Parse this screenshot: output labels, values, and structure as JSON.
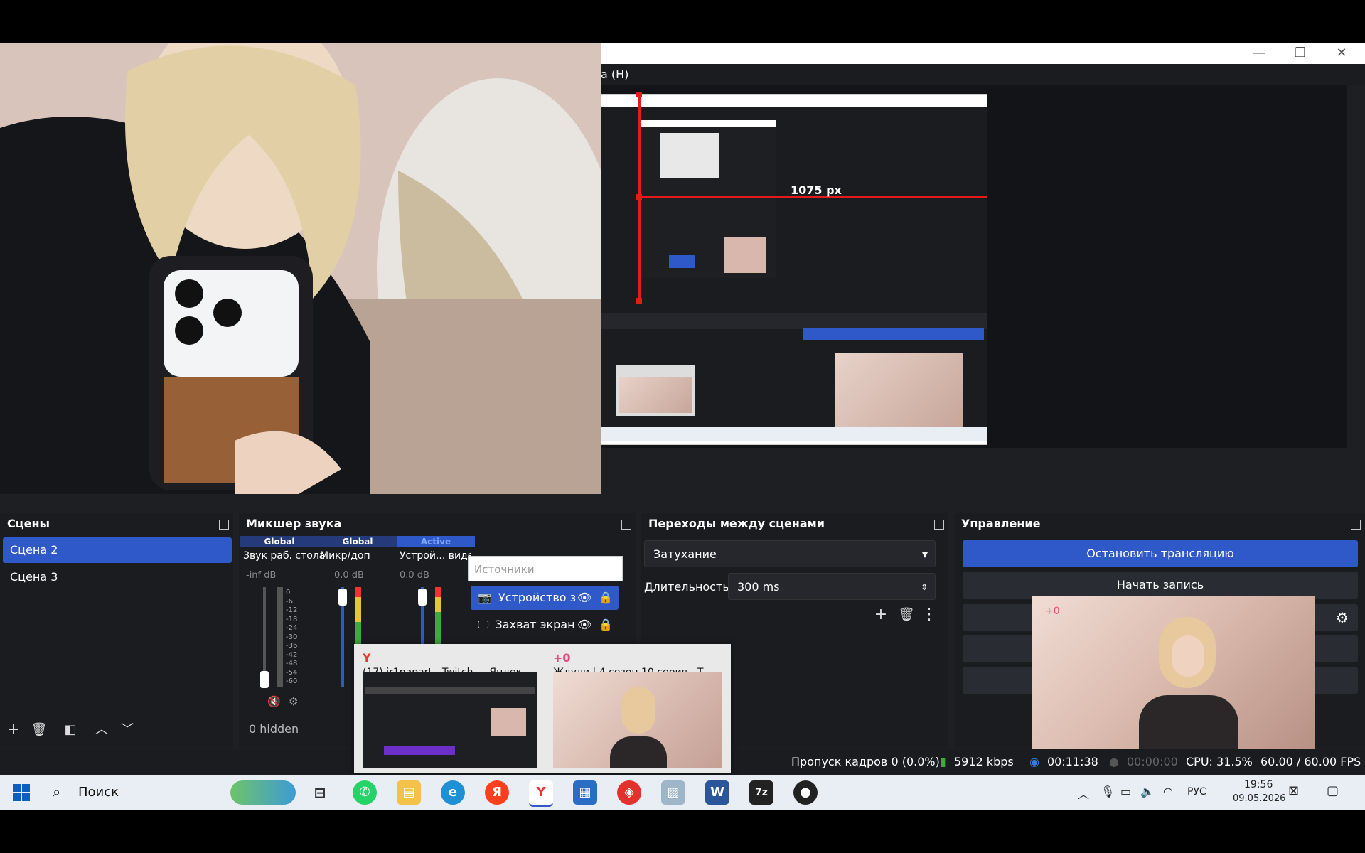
{
  "window": {
    "menu_fragment": "а (H)",
    "controls": {
      "minimize": "—",
      "restore": "❐",
      "close": "✕"
    }
  },
  "preview": {
    "dimension_label": "1075 px",
    "inner_scale_label": "1075 px"
  },
  "scenes": {
    "title": "Сцены",
    "items": [
      {
        "label": "Сцена 2",
        "active": true
      },
      {
        "label": "Сцена 3",
        "active": false
      }
    ]
  },
  "sources_popup": {
    "header_placeholder": "Источники",
    "items": [
      {
        "label": "Устройство з",
        "selected": true
      },
      {
        "label": "Захват экран",
        "selected": false
      }
    ]
  },
  "mixer": {
    "title": "Микшер звука",
    "channels": [
      {
        "tag": "Global",
        "name": "Звук раб. стола",
        "level": "-inf dB"
      },
      {
        "tag": "Global",
        "name": "Микр/доп",
        "level": "0.0 dB"
      },
      {
        "tag": "Active",
        "name": "Устрой... видео",
        "level": "0.0 dB"
      }
    ],
    "scale": [
      "0",
      "-6",
      "-12",
      "-18",
      "-24",
      "-30",
      "-36",
      "-42",
      "-48",
      "-54",
      "-60"
    ],
    "hidden_label": "0 hidden"
  },
  "transitions": {
    "title": "Переходы между сценами",
    "selected": "Затухание",
    "duration_label": "Длительность",
    "duration_value": "300 ms"
  },
  "controls": {
    "title": "Управление",
    "stop_stream": "Остановить трансляцию",
    "start_record": "Начать запись"
  },
  "taskbar_preview": {
    "items": [
      {
        "title": "(17) ir1napart - Twitch — Яндек..."
      },
      {
        "title": "Ждули | 4 сезон 10 серия - Т..."
      }
    ]
  },
  "status": {
    "dropped_frames": "Пропуск кадров 0 (0.0%)",
    "bitrate": "5912 kbps",
    "stream_time": "00:11:38",
    "record_time": "00:00:00",
    "cpu": "CPU: 31.5%",
    "fps": "60.00 / 60.00 FPS"
  },
  "taskbar": {
    "search_placeholder": "Поиск",
    "language": "РУС",
    "time": "19:56",
    "date": "09.05.2026",
    "yandex_letter": "Я",
    "word_letter": "W",
    "sevenzip_label": "7z"
  },
  "colors": {
    "accent": "#2f58c9",
    "dock_bg": "#1b1c20",
    "selection_red": "#e31b1b"
  }
}
